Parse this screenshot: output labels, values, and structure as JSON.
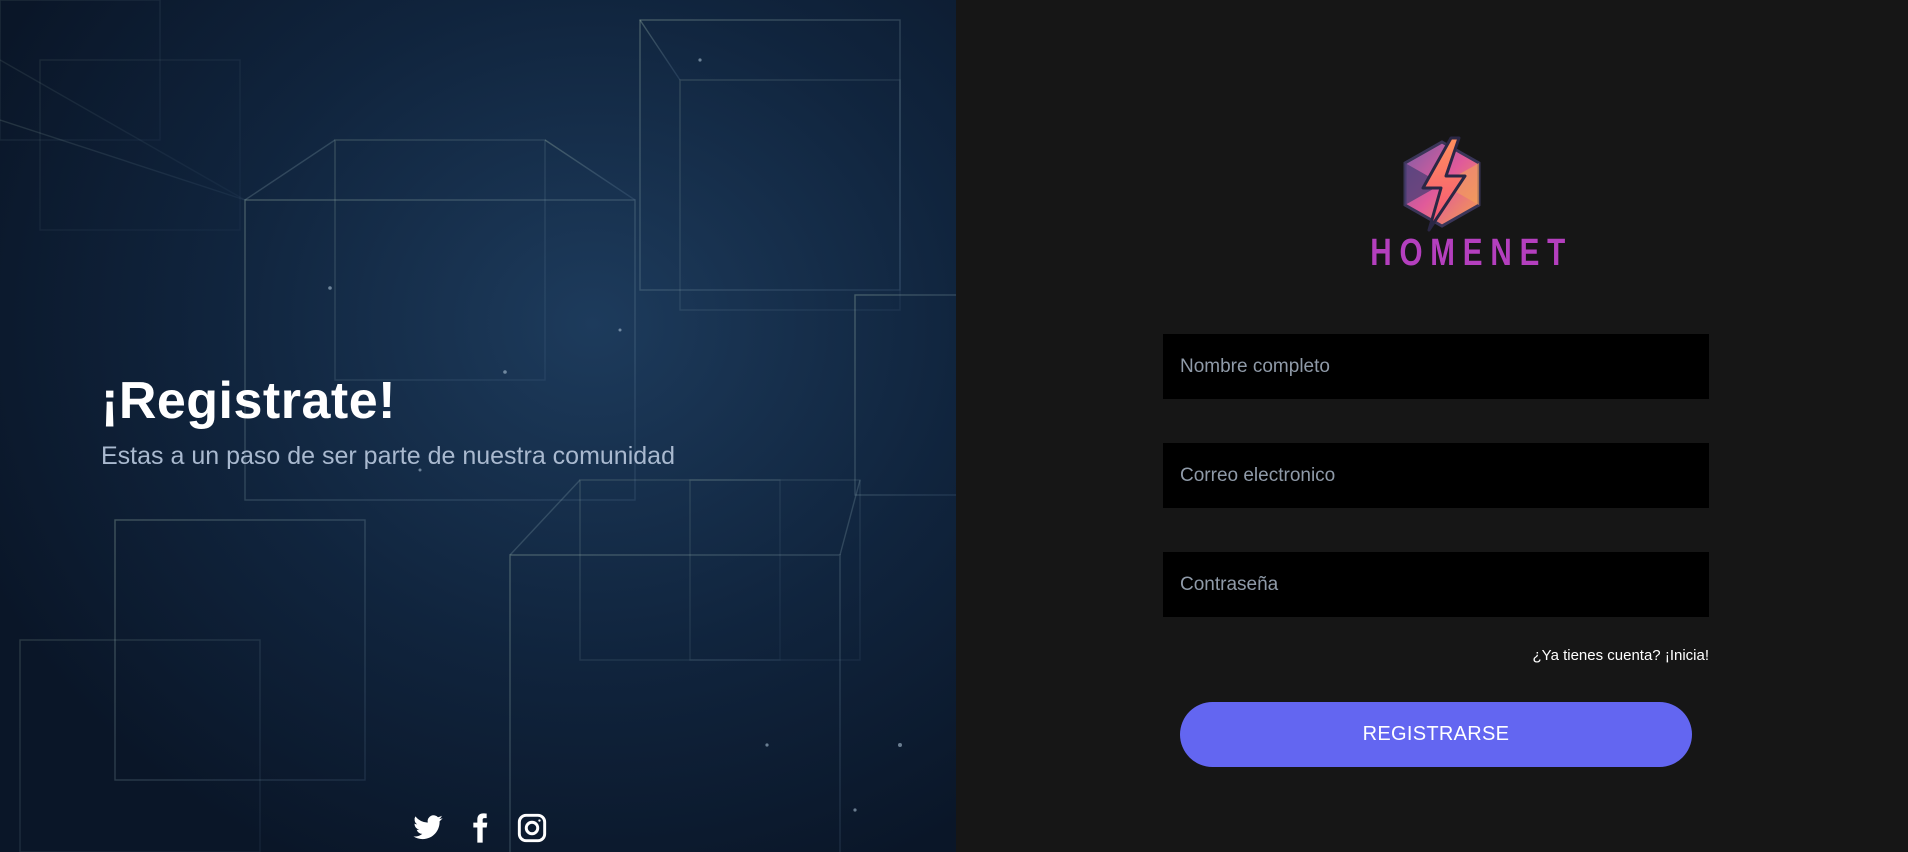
{
  "hero": {
    "title": "¡Registrate!",
    "subtitle": "Estas a un paso de ser parte de nuestra comunidad",
    "socials": [
      {
        "icon": "twitter-icon"
      },
      {
        "icon": "facebook-icon"
      },
      {
        "icon": "instagram-icon"
      }
    ]
  },
  "brand": {
    "name": "HOMENET",
    "logo_icon": "lightning-hexagon-icon",
    "colors": {
      "text": "#b43fbe",
      "bolt": "#f77d73",
      "hex": "#5a4a8a"
    }
  },
  "form": {
    "name_placeholder": "Nombre completo",
    "email_placeholder": "Correo electronico",
    "password_placeholder": "Contraseña",
    "login_link": "¿Ya tienes cuenta? ¡Inicia!",
    "submit_label": "REGISTRARSE"
  },
  "colors": {
    "panel_bg": "#161616",
    "input_bg": "#000000",
    "button_bg": "#6366f1",
    "hero_bg": "#0f2239"
  }
}
